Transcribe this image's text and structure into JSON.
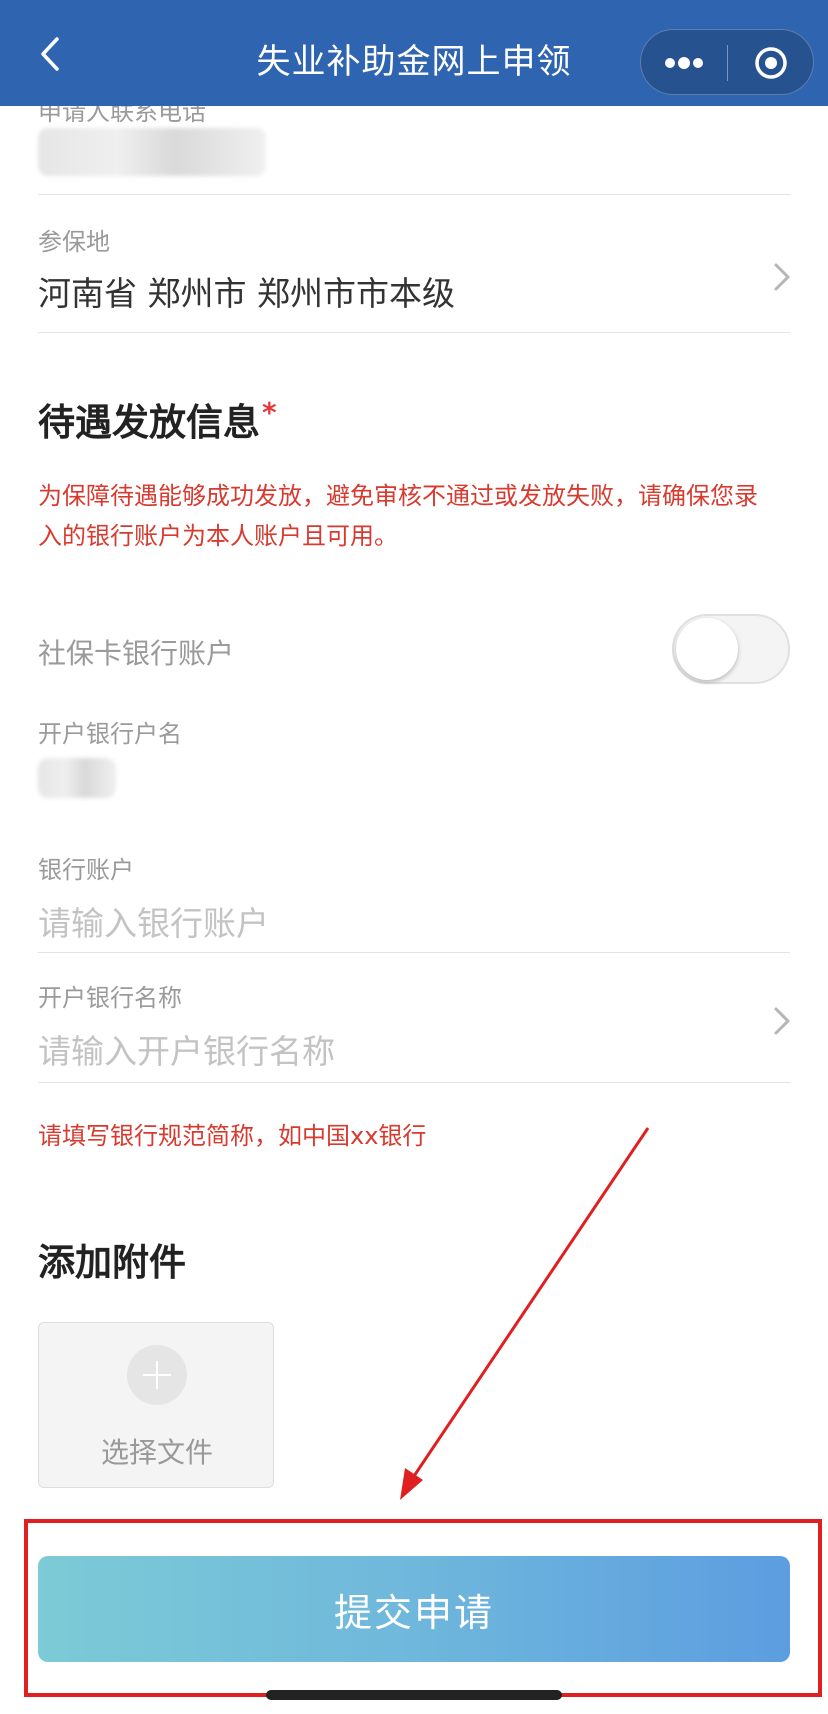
{
  "header": {
    "title": "失业补助金网上申领",
    "back_icon": "chevron-left-icon",
    "more_icon": "more-dots-icon",
    "close_icon": "target-circle-icon"
  },
  "form": {
    "phone": {
      "label": "申请人联系电话"
    },
    "insured_place": {
      "label": "参保地",
      "value": "河南省 郑州市 郑州市市本级"
    },
    "payout_section": {
      "title": "待遇发放信息",
      "required_mark": "*",
      "warning": "为保障待遇能够成功发放，避免审核不通过或发放失败，请确保您录入的银行账户为本人账户且可用。"
    },
    "social_card_account": {
      "label": "社保卡银行账户",
      "toggle_on": false
    },
    "account_name": {
      "label": "开户银行户名"
    },
    "bank_account": {
      "label": "银行账户",
      "placeholder": "请输入银行账户"
    },
    "bank_name": {
      "label": "开户银行名称",
      "placeholder": "请输入开户银行名称"
    },
    "bank_name_hint": "请填写银行规范简称，如中国xx银行"
  },
  "attachments": {
    "title": "添加附件",
    "choose_label": "选择文件"
  },
  "submit": {
    "label": "提交申请"
  },
  "colors": {
    "header_bg": "#2f64b0",
    "warning_text": "#d73b30",
    "annotation_red": "#e02020"
  }
}
